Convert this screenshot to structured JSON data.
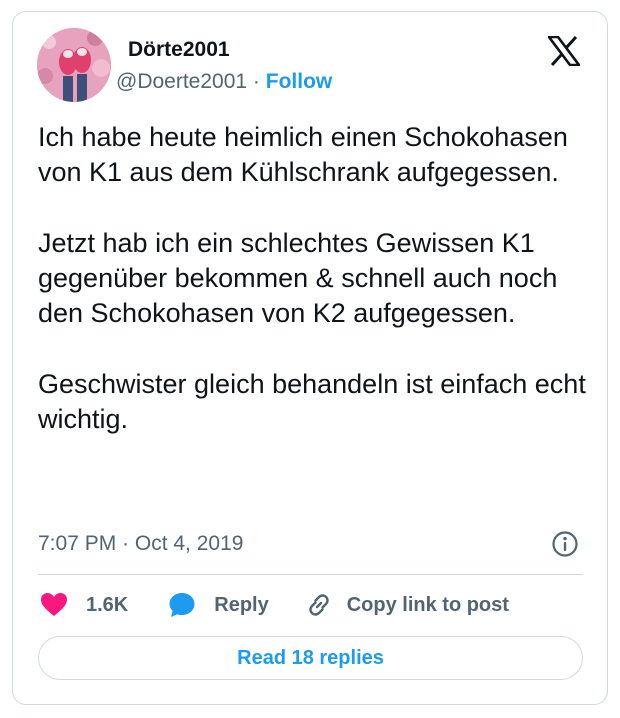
{
  "author": {
    "name": "Dörte2001",
    "handle": "@Doerte2001",
    "separator": "·",
    "follow_label": "Follow"
  },
  "tweet": {
    "paragraphs": [
      "Ich habe heute heimlich einen Schokohasen von K1 aus dem Kühlschrank aufgegessen.",
      "Jetzt hab ich ein schlechtes Gewissen K1 gegenüber bekommen & schnell auch noch den Schokohasen von K2 aufgegessen.",
      "Geschwister gleich behandeln ist einfach echt wichtig."
    ],
    "timestamp": "7:07 PM · Oct 4, 2019"
  },
  "actions": {
    "likes": "1.6K",
    "reply_label": "Reply",
    "copy_label": "Copy link to post"
  },
  "read_replies_label": "Read 18 replies",
  "icons": {
    "logo": "x-logo-icon",
    "info": "info-icon",
    "like": "heart-icon",
    "reply": "speech-bubble-icon",
    "copy": "link-icon"
  },
  "colors": {
    "accent": "#1d9bf0",
    "like": "#f91880",
    "text": "#0f1419",
    "muted": "#536471",
    "border": "#cfd9de"
  }
}
